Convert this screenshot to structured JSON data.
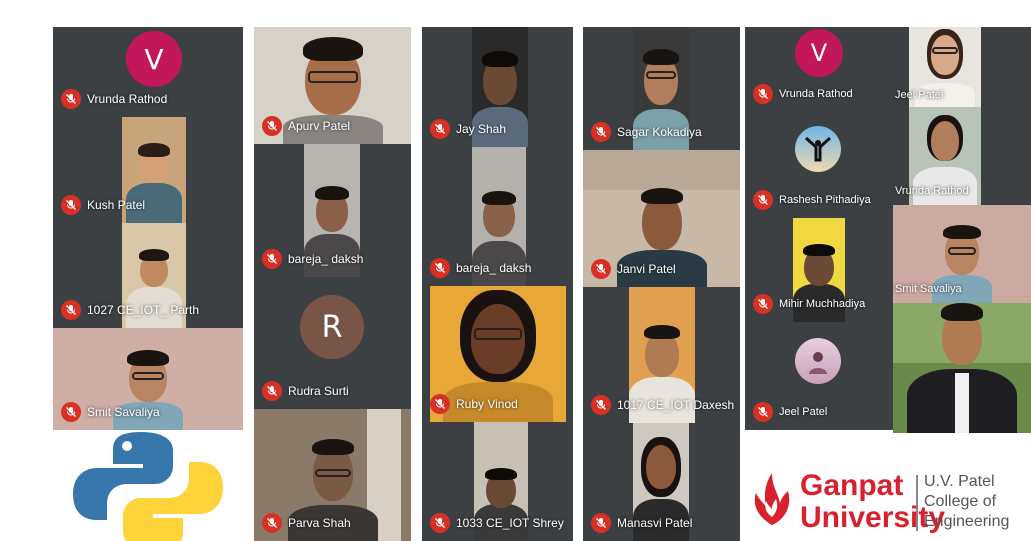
{
  "participants": {
    "vrunda_rathod_1": "Vrunda Rathod",
    "kush_patel": "Kush Patel",
    "parth": "1027 CE_IOT_ Parth",
    "smit_savaliya_1": "Smit Savaliya",
    "apurv_patel": "Apurv Patel",
    "bareja_daksh_1": "bareja_ daksh",
    "rudra_surti": "Rudra Surti",
    "parva_shah": "Parva Shah",
    "jay_shah": "Jay Shah",
    "bareja_daksh_2": "bareja_ daksh",
    "ruby_vinod": "Ruby Vinod",
    "shrey": "1033 CE_IOT Shrey",
    "sagar_kokadiya": "Sagar Kokadiya",
    "janvi_patel": "Janvi Patel",
    "daxesh": "1017 CE_IOT Daxesh",
    "manasvi_patel": "Manasvi Patel",
    "vrunda_rathod_2": "Vrunda Rathod",
    "rashesh_pithadiya": "Rashesh Pithadiya",
    "mihir_muchhadiya": "Mihir Muchhadiya",
    "jeel_patel_1": "Jeel Patel",
    "jeel_patel_2": "Jeel Patel",
    "vrunda_rathod_3": "Vrunda Rathod",
    "smit_savaliya_2": "Smit Savaliya"
  },
  "avatars": {
    "vrunda_initial": "V",
    "rudra_initial": "R",
    "vrunda_initial_2": "V"
  },
  "branding": {
    "university_line1": "Ganpat",
    "university_line2": "University",
    "college_line1": "U.V. Patel",
    "college_line2": "College of",
    "college_line3": "Engineering"
  },
  "colors": {
    "tile_bg": "#3c4043",
    "mic_muted": "#d93025",
    "avatar_magenta": "#c2185b",
    "avatar_brown": "#795548",
    "ganpat_red": "#d8202e",
    "python_blue": "#3776ab",
    "python_yellow": "#ffd43b"
  }
}
